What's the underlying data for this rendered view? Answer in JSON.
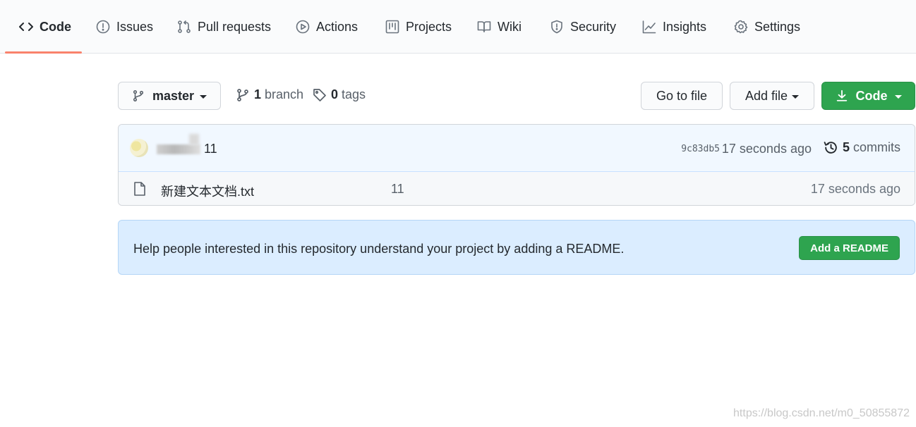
{
  "nav": {
    "tabs": [
      {
        "label": "Code",
        "icon": "code-icon",
        "active": true
      },
      {
        "label": "Issues",
        "icon": "issue-opened-icon"
      },
      {
        "label": "Pull requests",
        "icon": "git-pull-request-icon"
      },
      {
        "label": "Actions",
        "icon": "play-icon"
      },
      {
        "label": "Projects",
        "icon": "project-icon"
      },
      {
        "label": "Wiki",
        "icon": "book-icon"
      },
      {
        "label": "Security",
        "icon": "shield-icon"
      },
      {
        "label": "Insights",
        "icon": "graph-icon"
      },
      {
        "label": "Settings",
        "icon": "gear-icon"
      }
    ],
    "active_color": "#f9826c"
  },
  "toolbar": {
    "branch_select": "master",
    "branch_count": "1",
    "branch_label": "branch",
    "tag_count": "0",
    "tag_label": "tags",
    "go_to_file": "Go to file",
    "add_file": "Add file",
    "code_button": "Code"
  },
  "latest_commit": {
    "message": "11",
    "sha": "9c83db5",
    "time": "17 seconds ago",
    "commit_count": "5",
    "commit_label": "commits"
  },
  "files": [
    {
      "name": "新建文本文档.txt",
      "message": "11",
      "time": "17 seconds ago",
      "icon": "file-icon"
    }
  ],
  "readme_banner": {
    "text": "Help people interested in this repository understand your project by adding a README.",
    "button": "Add a README"
  },
  "colors": {
    "primary_green": "#2ea44f",
    "banner_blue": "#dbedff",
    "commit_row_blue": "#f1f8ff"
  },
  "watermark": "https://blog.csdn.net/m0_50855872"
}
